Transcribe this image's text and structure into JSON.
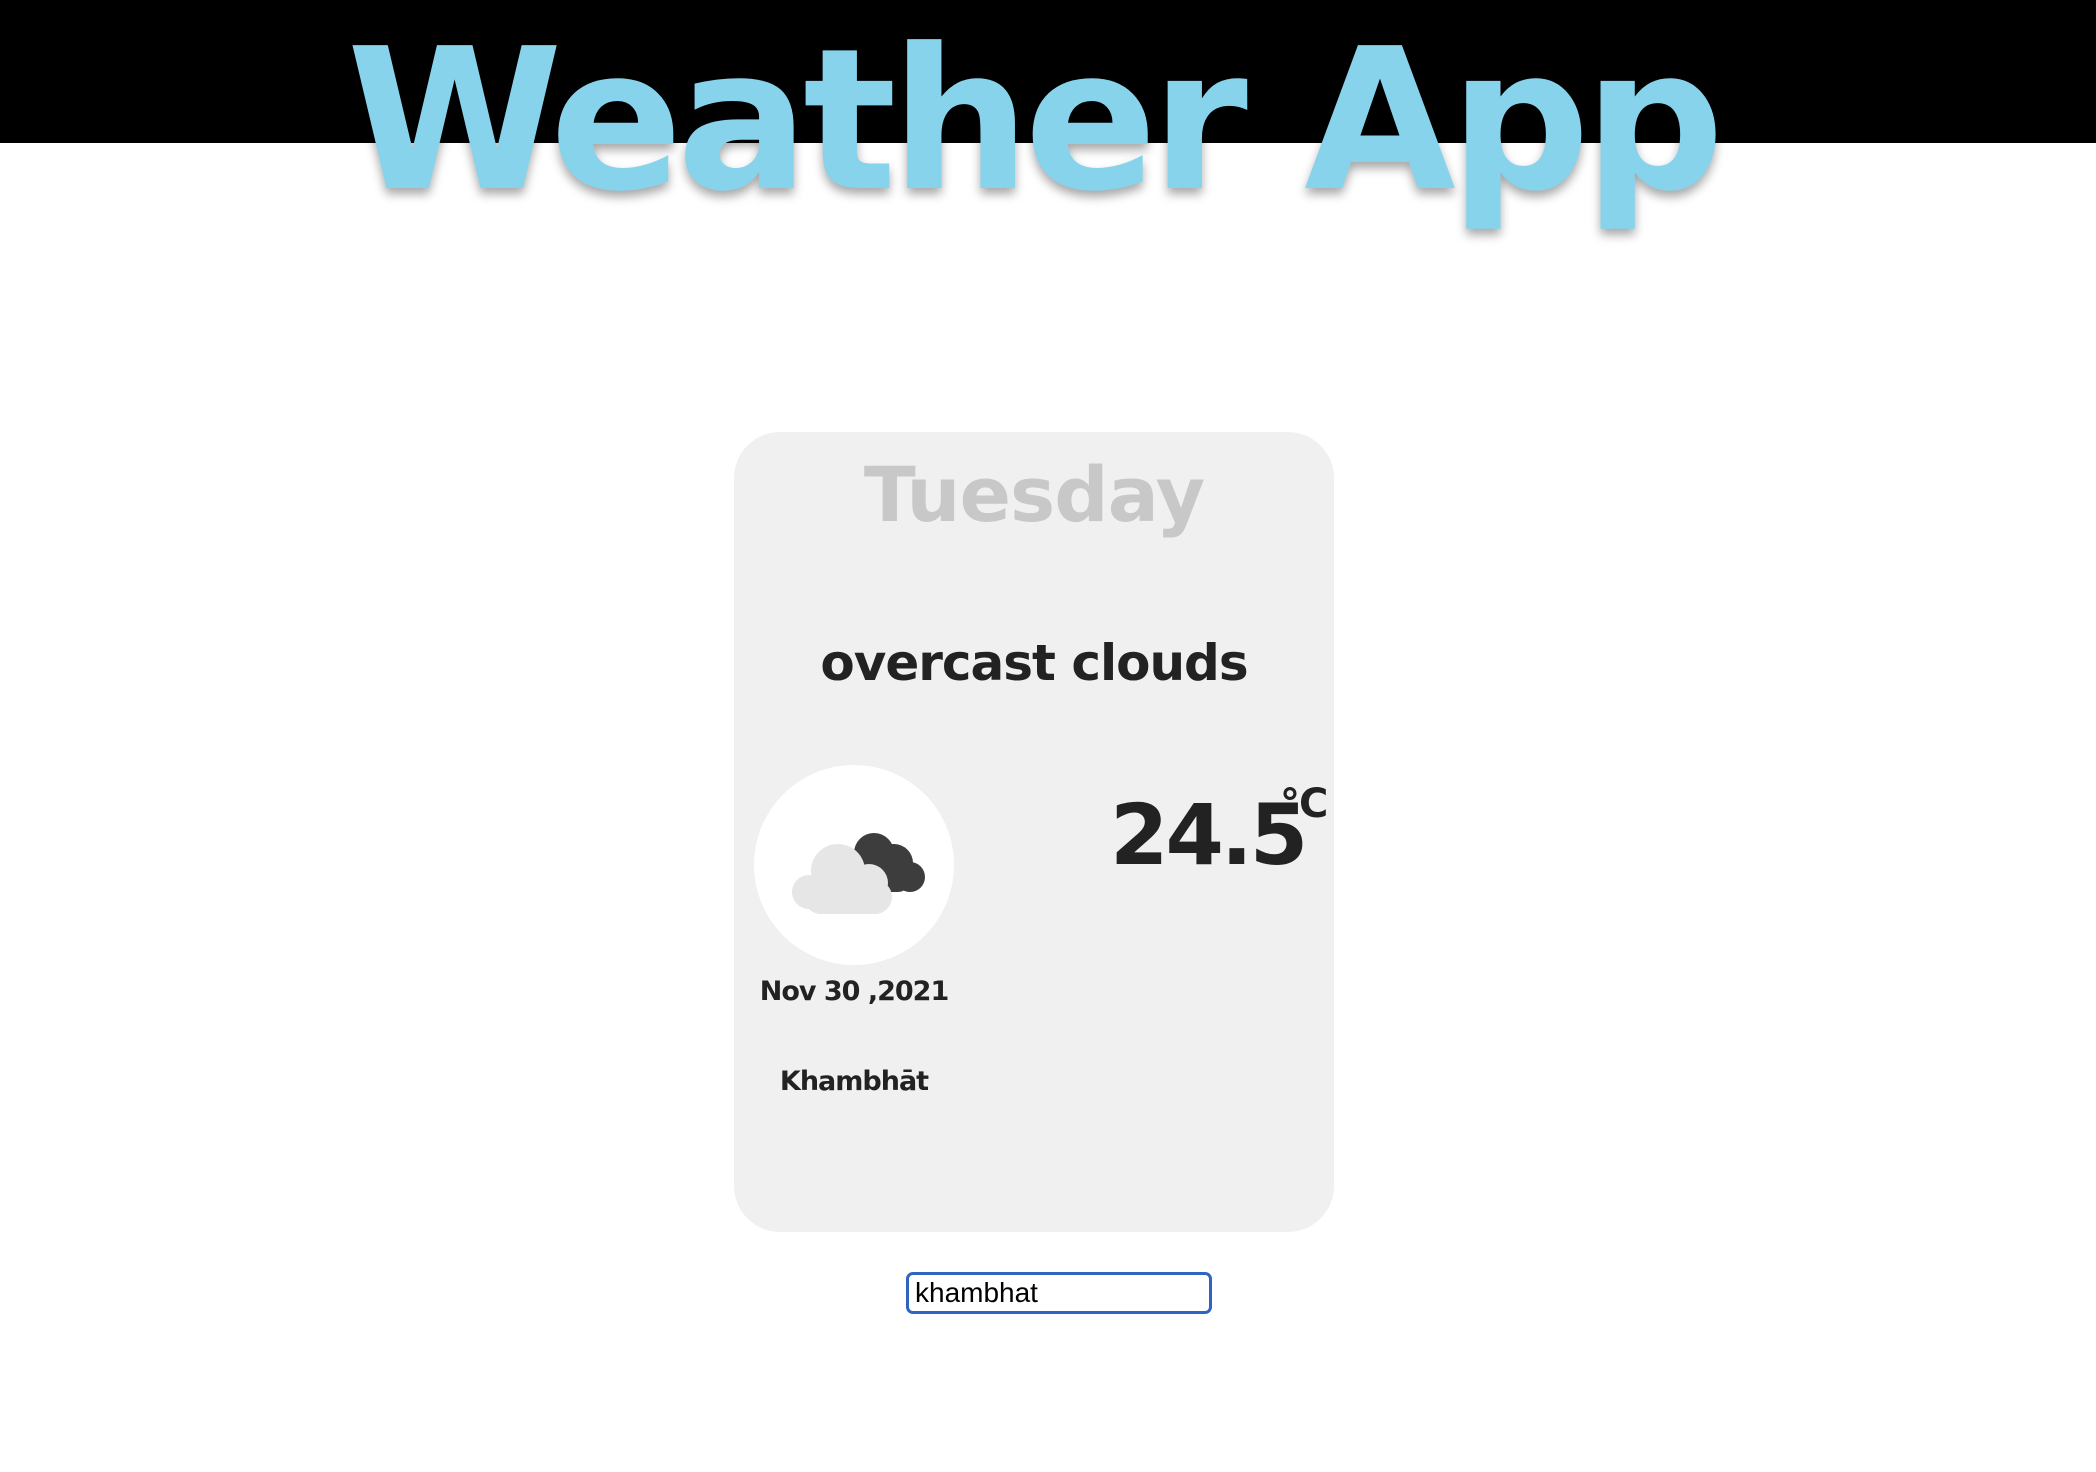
{
  "header": {
    "title": "Weather App"
  },
  "card": {
    "day": "Tuesday",
    "description": "overcast clouds",
    "temperature": "24.5",
    "unit": "°C",
    "date": "Nov 30 ,2021",
    "city": "Khambhāt",
    "icon": "overcast-clouds-icon"
  },
  "search": {
    "value": "khambhat",
    "placeholder": ""
  },
  "colors": {
    "title": "#87d3ec",
    "topbar": "#000000",
    "card_background": "#f0f0f0",
    "day_text": "#c8c8c8",
    "input_border": "#2f64c0"
  }
}
